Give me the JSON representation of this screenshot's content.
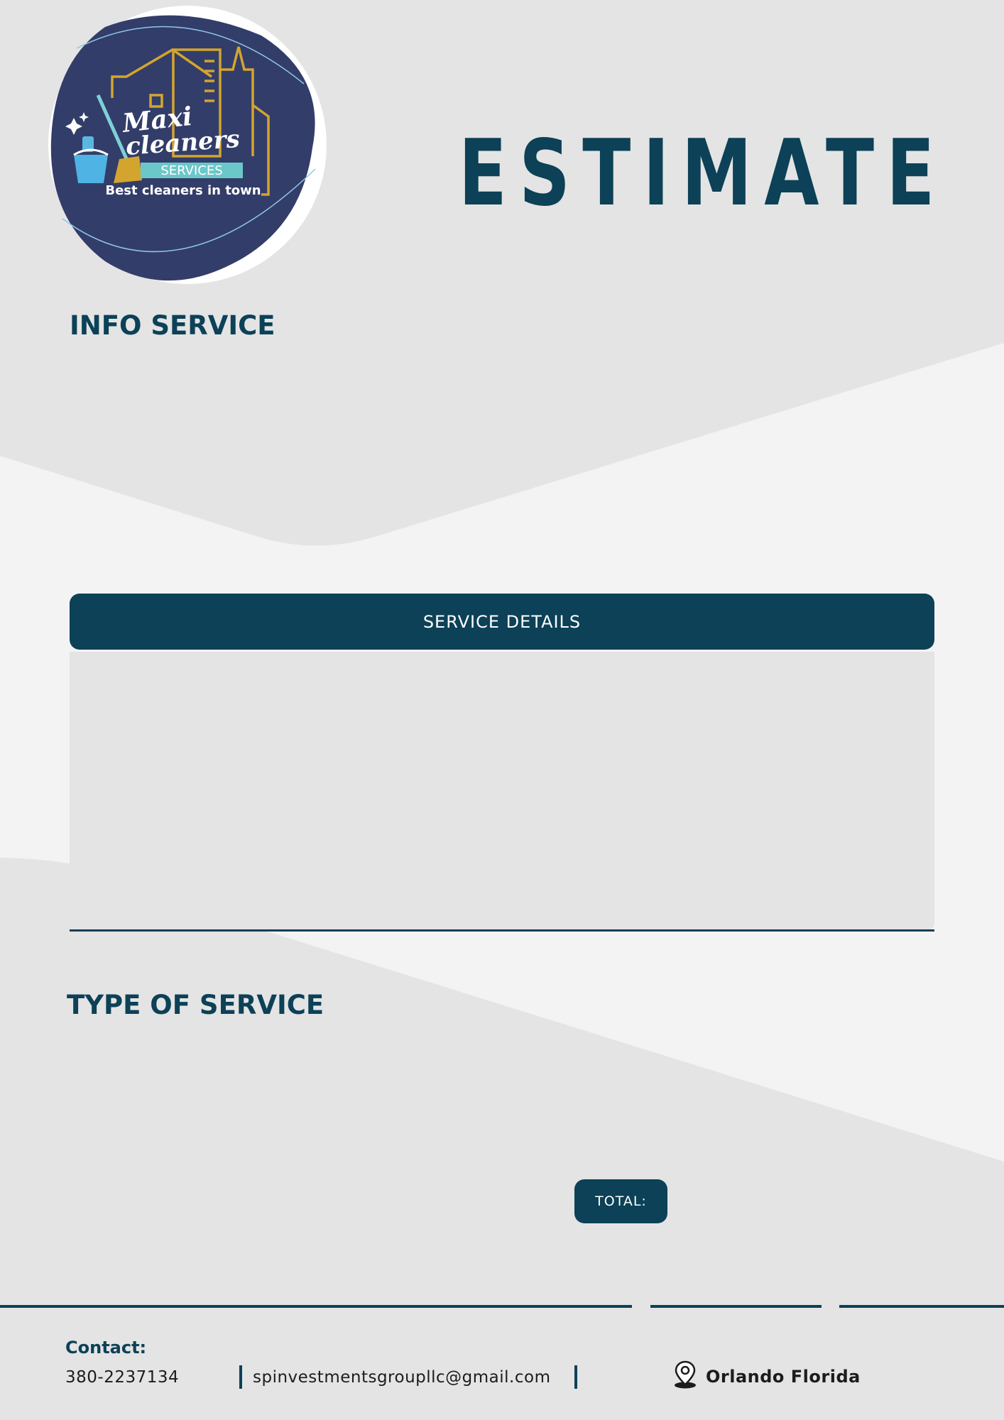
{
  "logo": {
    "brand_line1": "Maxi",
    "brand_line2": "cleaners",
    "services": "SERVICES",
    "tagline": "Best cleaners in town"
  },
  "title": "ESTIMATE",
  "info_heading": "INFO SERVICE",
  "details": {
    "header": "SERVICE DETAILS"
  },
  "type_heading": "TYPE OF SERVICE",
  "total_label": "TOTAL:",
  "footer": {
    "contact_label": "Contact:",
    "phone": "380-2237134",
    "email": "spinvestmentsgroupllc@gmail.com",
    "location": "Orlando Florida"
  },
  "colors": {
    "primary": "#0c4157",
    "logo_navy": "#333d69",
    "gold": "#d4a52e",
    "background": "#e4e4e4",
    "light_band": "#f3f3f3"
  },
  "icons": {
    "location": "map-pin-icon"
  }
}
